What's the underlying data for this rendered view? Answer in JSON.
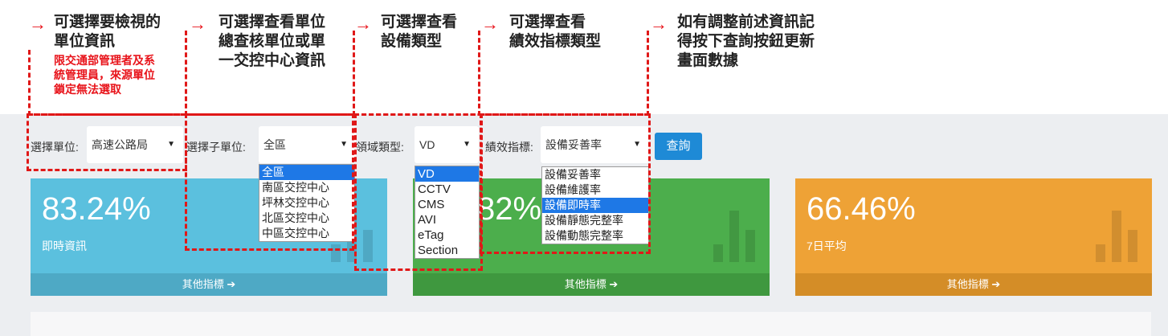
{
  "annotations": {
    "unit": {
      "title": "可選擇要檢視的\n單位資訊",
      "note": "限交通部管理者及系\n統管理員，來源單位\n鎖定無法選取"
    },
    "sub_unit": {
      "title": "可選擇查看單位\n總查核單位或單\n一交控中心資訊"
    },
    "domain": {
      "title": "可選擇查看\n設備類型"
    },
    "metric": {
      "title": "可選擇查看\n績效指標類型"
    },
    "query": {
      "title": "如有調整前述資訊記\n得按下查詢按鈕更新\n畫面數據"
    }
  },
  "filters": {
    "unit_label": "選擇單位:",
    "unit_value": "高速公路局",
    "sub_unit_label": "選擇子單位:",
    "sub_unit_value": "全區",
    "domain_label": "領域類型:",
    "domain_value": "VD",
    "metric_label": "績效指標:",
    "metric_value": "設備妥善率",
    "query_button": "查詢"
  },
  "sub_unit_options": [
    "全區",
    "南區交控中心",
    "坪林交控中心",
    "北區交控中心",
    "中區交控中心"
  ],
  "domain_options": [
    "VD",
    "CCTV",
    "CMS",
    "AVI",
    "eTag",
    "Section"
  ],
  "metric_options": [
    "設備妥善率",
    "設備維護率",
    "設備即時率",
    "設備靜態完整率",
    "設備動態完整率"
  ],
  "selected": {
    "sub_unit": 0,
    "domain": 0,
    "metric": 2
  },
  "cards": [
    {
      "value": "83.24%",
      "caption": "即時資訊",
      "footer": "其他指標 ➔",
      "color": "#5bc0de",
      "footer_color": "#4ea9c5"
    },
    {
      "value": "82%",
      "caption": "",
      "footer": "其他指標 ➔",
      "color": "#4cae4c",
      "footer_color": "#3f983f"
    },
    {
      "value": "66.46%",
      "caption": "7日平均",
      "footer": "其他指標 ➔",
      "color": "#eea236",
      "footer_color": "#d48d27"
    }
  ]
}
